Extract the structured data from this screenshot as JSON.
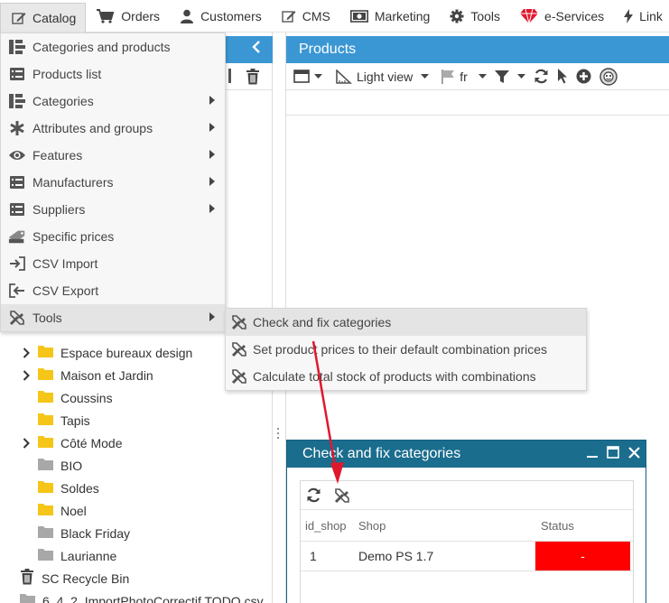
{
  "topbar": {
    "items": [
      {
        "label": "Catalog",
        "icon": "pencil-icon",
        "active": true
      },
      {
        "label": "Orders",
        "icon": "cart-icon"
      },
      {
        "label": "Customers",
        "icon": "user-icon"
      },
      {
        "label": "CMS",
        "icon": "pencil-icon"
      },
      {
        "label": "Marketing",
        "icon": "money-icon"
      },
      {
        "label": "Tools",
        "icon": "gear-icon"
      },
      {
        "label": "e-Services",
        "icon": "gem-icon"
      },
      {
        "label": "Link",
        "icon": "bolt-icon"
      }
    ]
  },
  "catalog_menu": {
    "items": [
      {
        "label": "Categories and products",
        "icon": "tree-icon",
        "submenu": false
      },
      {
        "label": "Products list",
        "icon": "list-icon",
        "submenu": false
      },
      {
        "label": "Categories",
        "icon": "tree-icon",
        "submenu": true
      },
      {
        "label": "Attributes and groups",
        "icon": "asterisk-icon",
        "submenu": true
      },
      {
        "label": "Features",
        "icon": "eye-icon",
        "submenu": true
      },
      {
        "label": "Manufacturers",
        "icon": "list-icon",
        "submenu": true
      },
      {
        "label": "Suppliers",
        "icon": "list-icon",
        "submenu": true
      },
      {
        "label": "Specific prices",
        "icon": "price-tag-icon",
        "submenu": false
      },
      {
        "label": "CSV Import",
        "icon": "import-icon",
        "submenu": false
      },
      {
        "label": "CSV Export",
        "icon": "export-icon",
        "submenu": false
      },
      {
        "label": "Tools",
        "icon": "tools-icon",
        "submenu": true,
        "hover": true
      }
    ]
  },
  "tools_submenu": {
    "items": [
      {
        "label": "Check and fix categories",
        "hover": true
      },
      {
        "label": "Set product prices to their default combination prices"
      },
      {
        "label": "Calculate total stock of products with combinations"
      }
    ]
  },
  "products_panel": {
    "title": "Products",
    "view_label": "Light view",
    "lang_label": "fr"
  },
  "tree": {
    "items": [
      {
        "label": "Espace bureaux design",
        "expandable": true,
        "color": "#f5c518"
      },
      {
        "label": "Maison et Jardin",
        "expandable": true,
        "color": "#f5c518"
      },
      {
        "label": "Coussins",
        "expandable": false,
        "color": "#f5c518"
      },
      {
        "label": "Tapis",
        "expandable": false,
        "color": "#f5c518"
      },
      {
        "label": "Côté Mode",
        "expandable": true,
        "color": "#f5c518"
      },
      {
        "label": "BIO",
        "expandable": false,
        "color": "#a8a8a8"
      },
      {
        "label": "Soldes",
        "expandable": false,
        "color": "#f5c518"
      },
      {
        "label": "Noel",
        "expandable": false,
        "color": "#f5c518"
      },
      {
        "label": "Black Friday",
        "expandable": false,
        "color": "#a8a8a8"
      },
      {
        "label": "Laurianne",
        "expandable": false,
        "color": "#a8a8a8"
      }
    ],
    "recycle_bin": "SC Recycle Bin",
    "last_item": "6_4_2_ImportPhotoCorrectif TODO.csv"
  },
  "dialog": {
    "title": "Check and fix categories",
    "columns": [
      "id_shop",
      "Shop",
      "Status"
    ],
    "rows": [
      {
        "id_shop": "1",
        "shop": "Demo PS 1.7",
        "status": "-"
      }
    ],
    "status_color": "#ff0000"
  },
  "colors": {
    "header_blue": "#3b97d3",
    "dialog_blue": "#1b6d8e",
    "annotation_red": "#e0182d"
  }
}
